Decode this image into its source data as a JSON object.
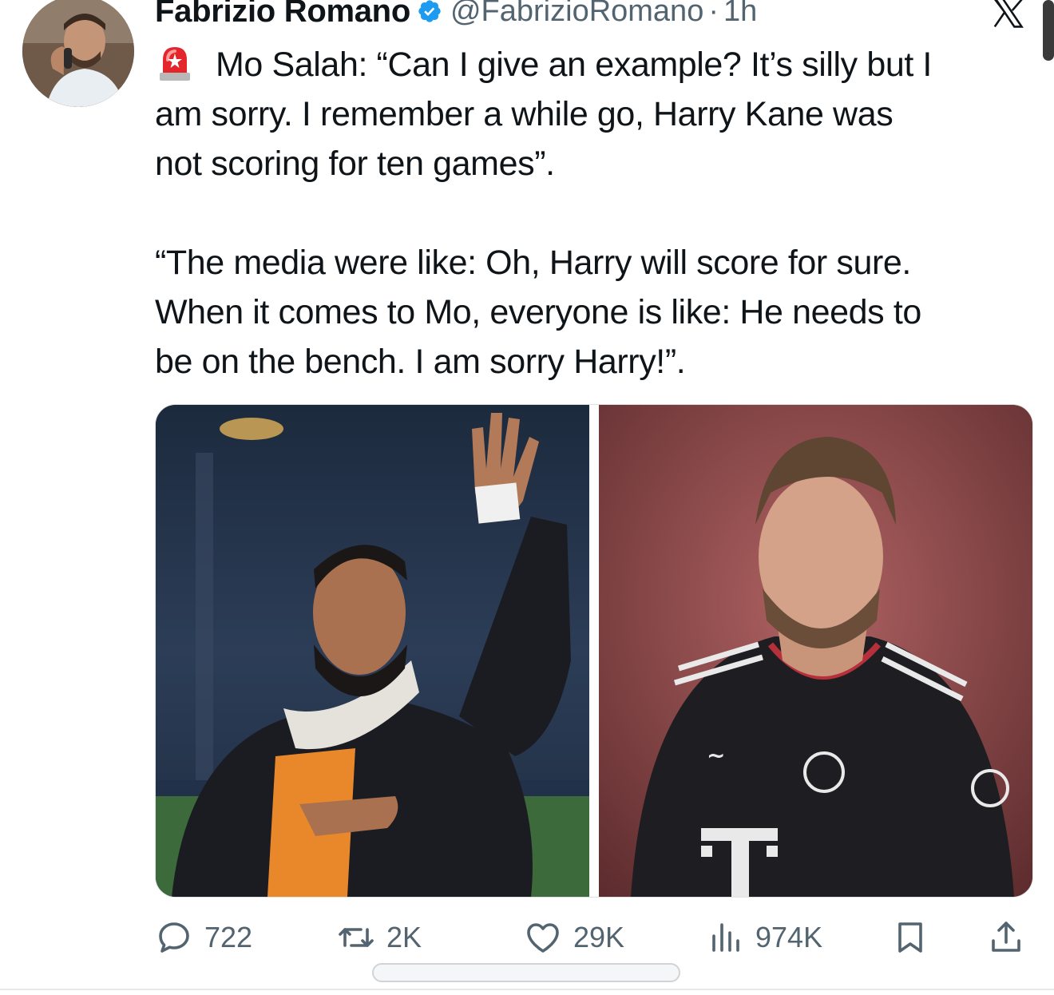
{
  "author": {
    "name": "Fabrizio Romano",
    "handle": "@FabrizioRomano",
    "separator": "·",
    "time": "1h"
  },
  "tweet": {
    "line1": "Mo Salah: “Can I give an example? It’s silly but I",
    "rest": "am sorry. I remember a while go, Harry Kane was\nnot scoring for ten games”.\n\n“The media were like: Oh, Harry will score for sure.\nWhen it comes to Mo, everyone is like: He needs to\nbe on the bench. I am sorry Harry!”."
  },
  "actions": {
    "replies": "722",
    "reposts": "2K",
    "likes": "29K",
    "views": "974K"
  },
  "colors": {
    "verified": "#1d9bf0",
    "text_primary": "#0f1419",
    "text_secondary": "#536471"
  },
  "icons": [
    "verified-badge-icon",
    "x-logo-icon",
    "siren-icon",
    "reply-icon",
    "repost-icon",
    "like-icon",
    "views-icon",
    "bookmark-icon",
    "share-icon"
  ]
}
